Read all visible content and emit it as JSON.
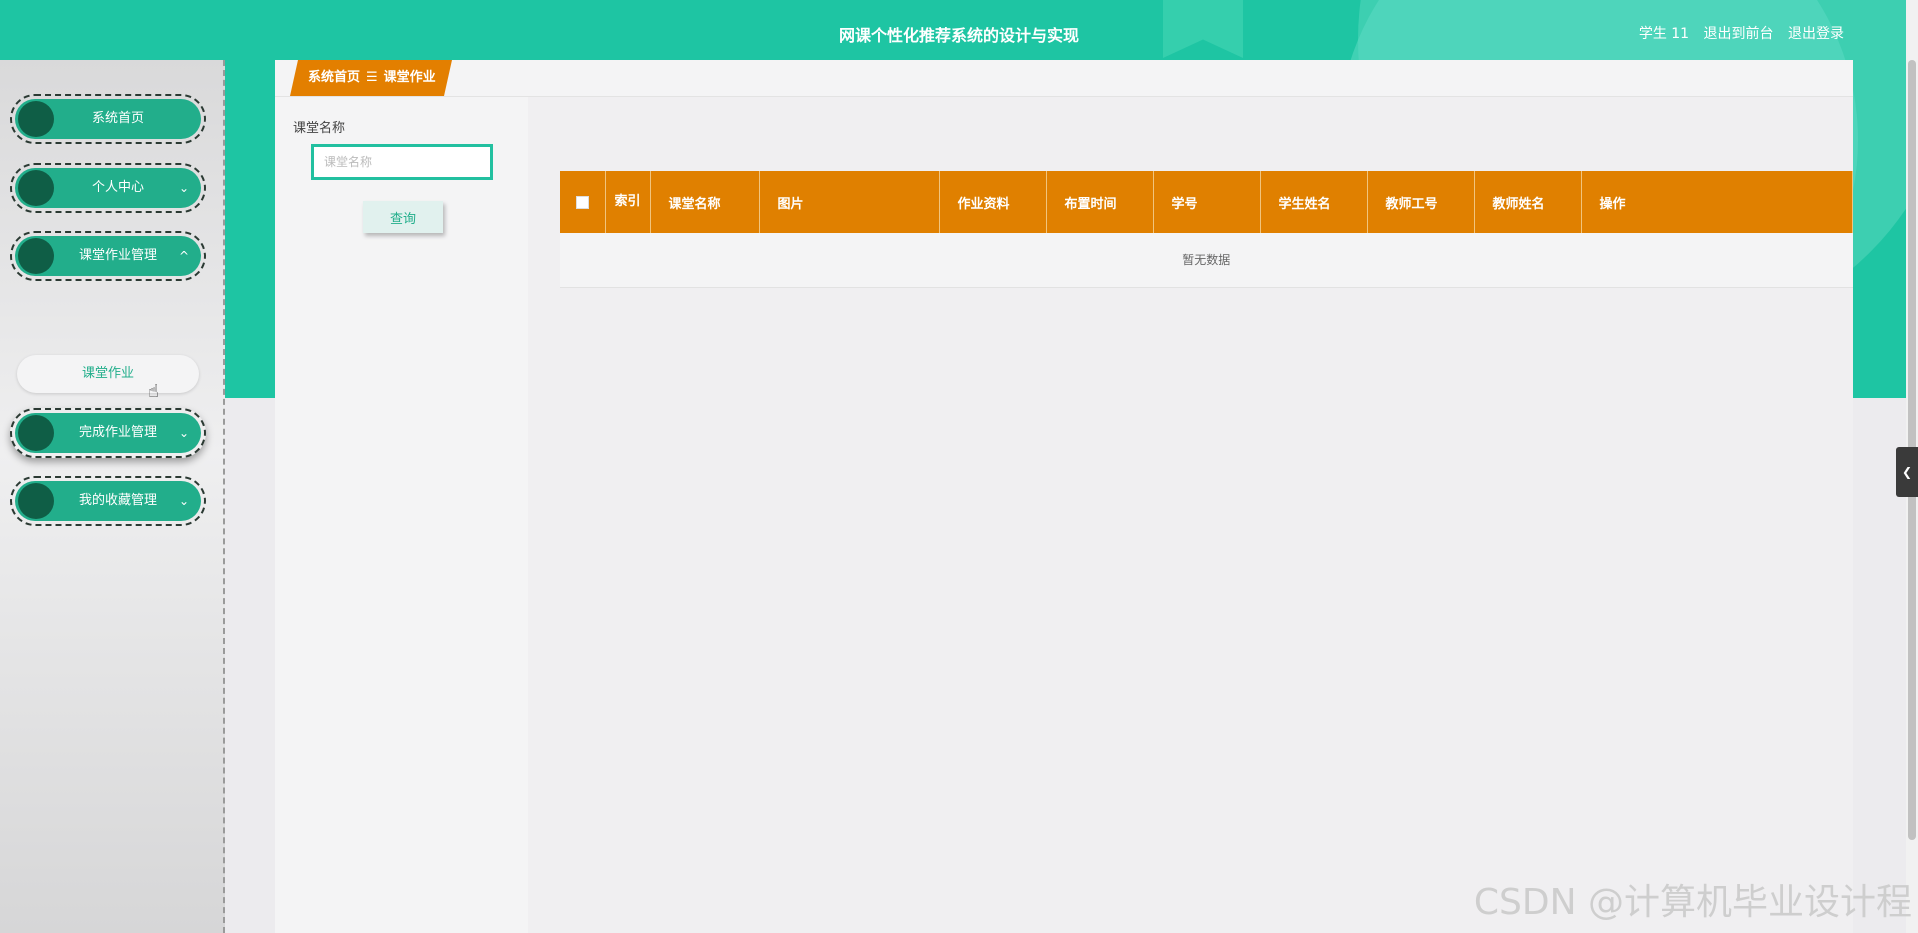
{
  "header": {
    "title": "网课个性化推荐系统的设计与实现",
    "user": "学生 11",
    "exit_front": "退出到前台",
    "logout": "退出登录"
  },
  "sidebar": {
    "items": [
      {
        "label": "系统首页",
        "chevron": ""
      },
      {
        "label": "个人中心",
        "chevron": "⌄"
      },
      {
        "label": "课堂作业管理",
        "chevron": "^"
      },
      {
        "label": "完成作业管理",
        "chevron": "⌄"
      },
      {
        "label": "我的收藏管理",
        "chevron": "⌄"
      }
    ],
    "submenu": {
      "label": "课堂作业"
    }
  },
  "breadcrumb": {
    "home": "系统首页",
    "separator": "☰",
    "current": "课堂作业"
  },
  "filter": {
    "label": "课堂名称",
    "placeholder": "课堂名称",
    "value": "",
    "button": "查询"
  },
  "table": {
    "columns": [
      "索引",
      "课堂名称",
      "图片",
      "作业资料",
      "布置时间",
      "学号",
      "学生姓名",
      "教师工号",
      "教师姓名",
      "操作"
    ],
    "empty_text": "暂无数据"
  },
  "colors": {
    "primary": "#1ec5a3",
    "menu": "#22ae8b",
    "table_header": "#e08000"
  },
  "watermark": "CSDN @计算机毕业设计程",
  "icons": {
    "side_tab": "chevron-left-icon"
  }
}
